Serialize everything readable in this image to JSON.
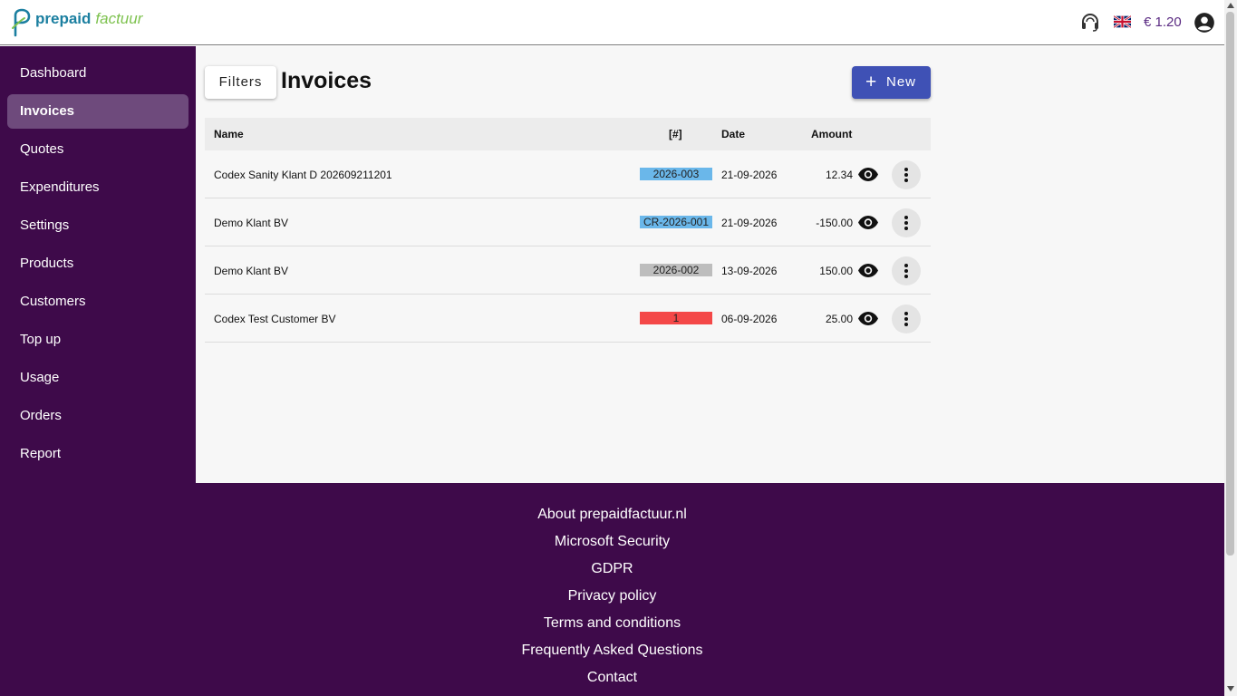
{
  "header": {
    "logo_prepaid": "prepaid",
    "logo_factuur": "factuur",
    "balance": "€ 1.20",
    "support_icon": "headset-icon",
    "language_flag": "uk-flag-icon",
    "account_icon": "account-circle-icon"
  },
  "sidebar": {
    "items": [
      {
        "label": "Dashboard"
      },
      {
        "label": "Invoices",
        "active": true
      },
      {
        "label": "Quotes"
      },
      {
        "label": "Expenditures"
      },
      {
        "label": "Settings"
      },
      {
        "label": "Products"
      },
      {
        "label": "Customers"
      },
      {
        "label": "Top up"
      },
      {
        "label": "Usage"
      },
      {
        "label": "Orders"
      },
      {
        "label": "Report"
      }
    ]
  },
  "main": {
    "filters_label": "Filters",
    "title": "Invoices",
    "new_label": "New",
    "table": {
      "columns": [
        "Name",
        "[#]",
        "Date",
        "Amount"
      ],
      "rows": [
        {
          "name": "Codex Sanity Klant D 202609211201",
          "number": "2026-003",
          "number_color": "#6ab7ea",
          "date": "21-09-2026",
          "amount": "12.34"
        },
        {
          "name": "Demo Klant BV",
          "number": "CR-2026-001",
          "number_color": "#6ab7ea",
          "date": "21-09-2026",
          "amount": "-150.00"
        },
        {
          "name": "Demo Klant BV",
          "number": "2026-002",
          "number_color": "#bdbdbd",
          "date": "13-09-2026",
          "amount": "150.00"
        },
        {
          "name": "Codex Test Customer BV",
          "number": "1",
          "number_color": "#f44848",
          "date": "06-09-2026",
          "amount": "25.00"
        }
      ]
    }
  },
  "footer": {
    "links": [
      "About prepaidfactuur.nl",
      "Microsoft Security",
      "GDPR",
      "Privacy policy",
      "Terms and conditions",
      "Frequently Asked Questions",
      "Contact"
    ]
  },
  "colors": {
    "brand_purple": "#3e0a4a",
    "sidebar_active": "#6e4a7c",
    "primary_button": "#3f51b5"
  }
}
